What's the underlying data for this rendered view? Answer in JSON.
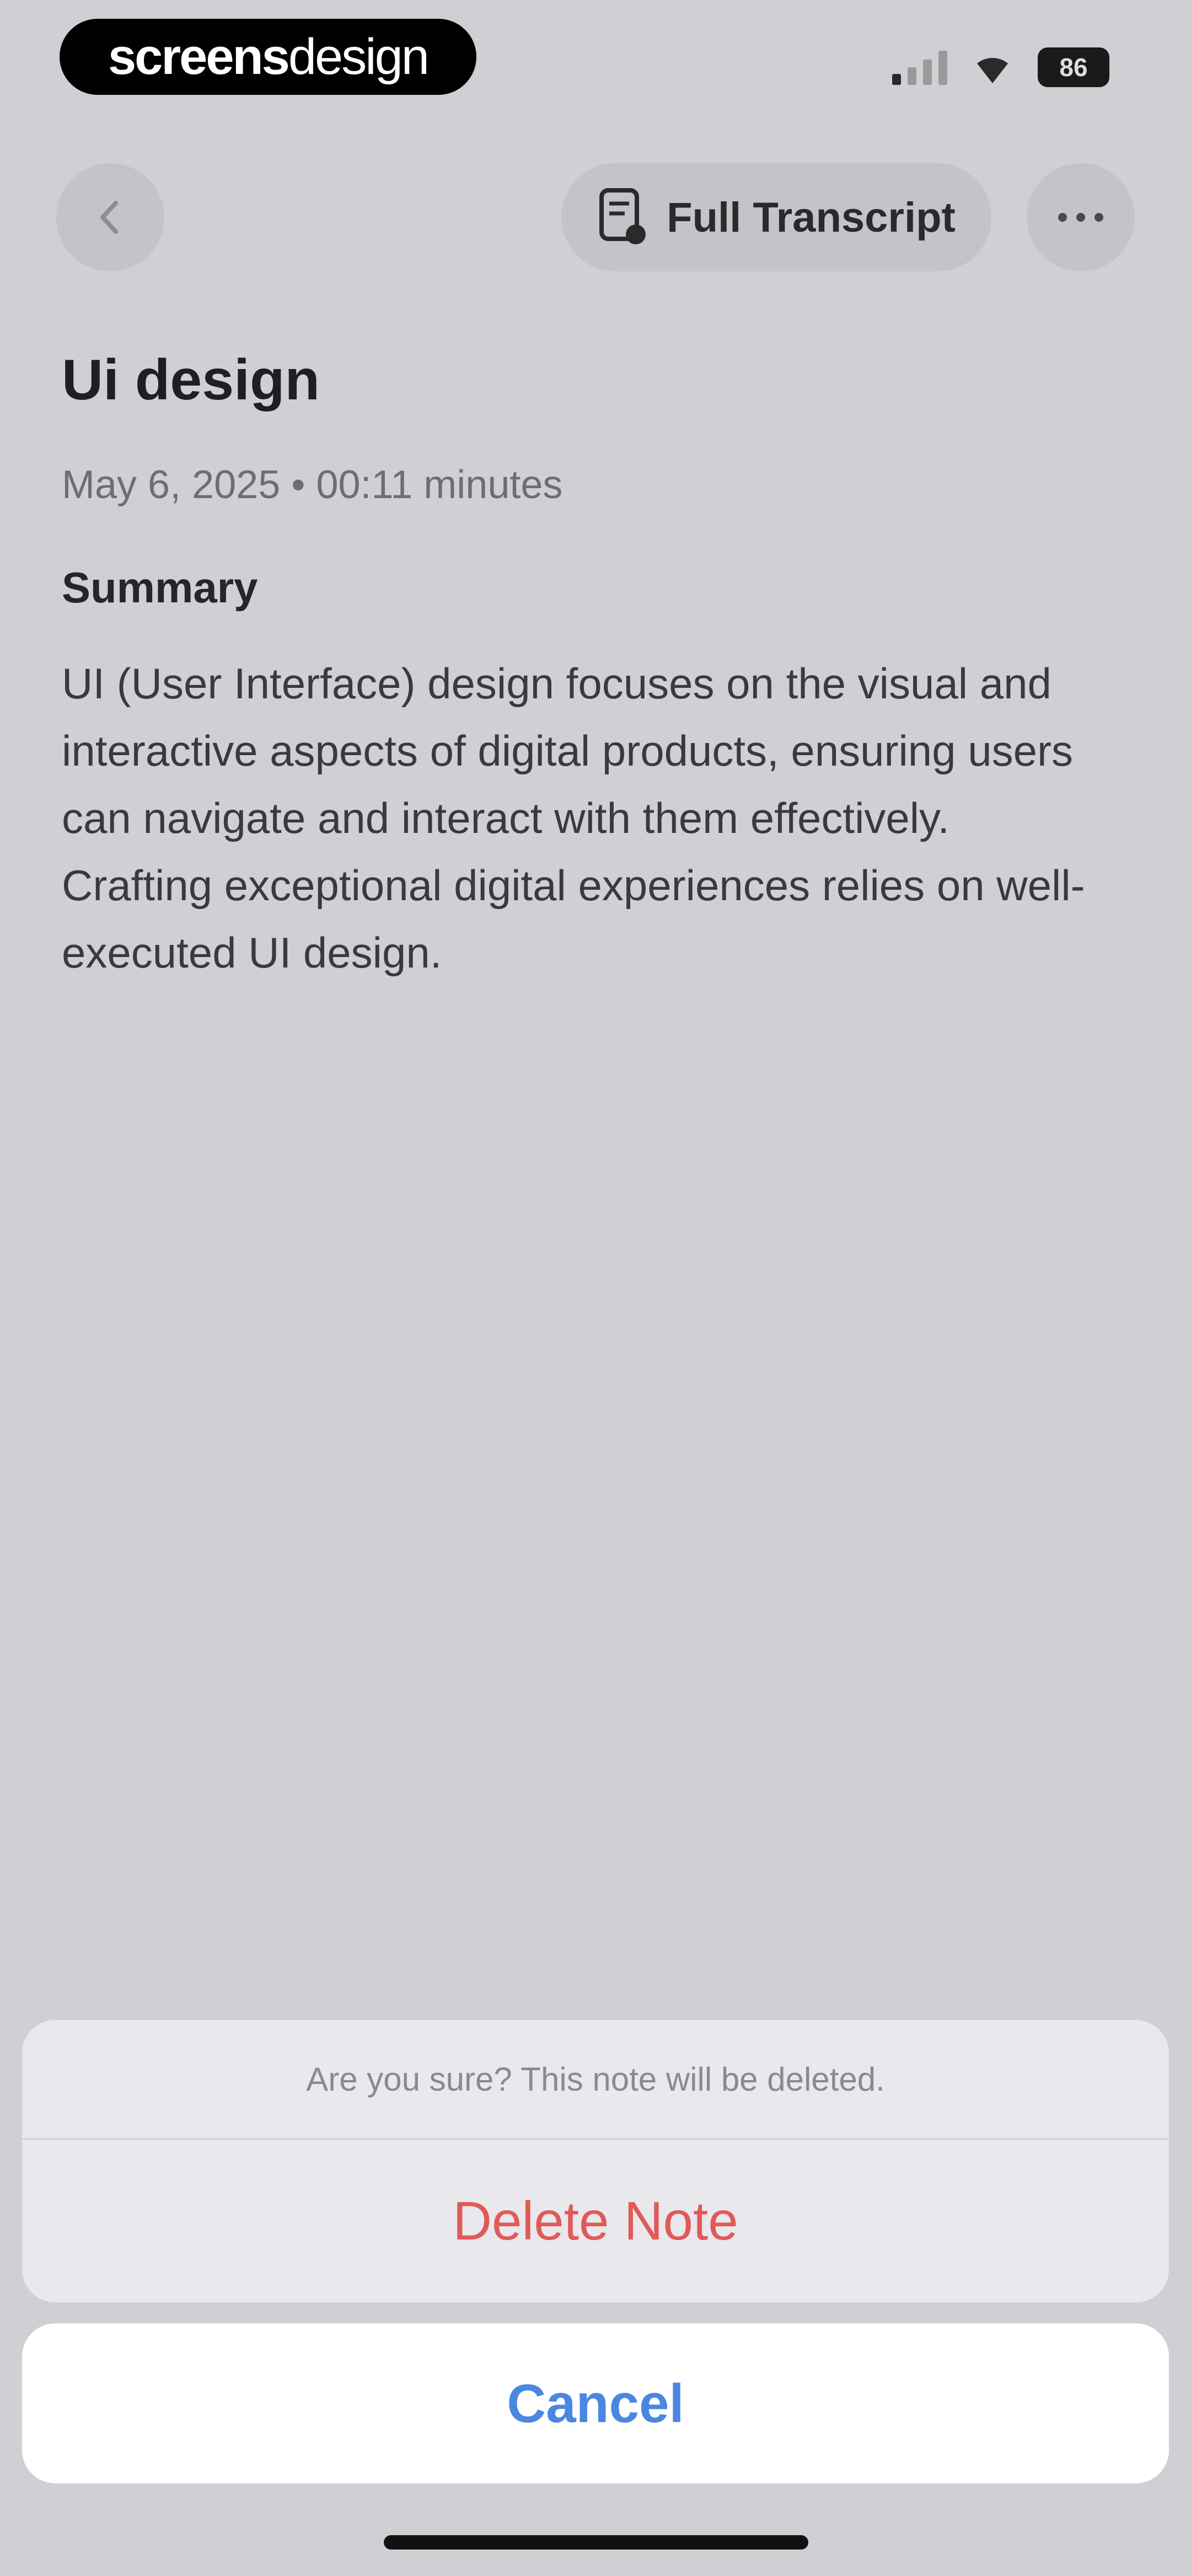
{
  "status_bar": {
    "logo_bold": "screens",
    "logo_light": "design",
    "signal_icon": "cellular-signal-icon",
    "wifi_icon": "wifi-icon",
    "battery_level": "86"
  },
  "header": {
    "back_icon": "chevron-left-icon",
    "transcript_icon": "document-icon",
    "transcript_label": "Full Transcript",
    "more_icon": "ellipsis-icon"
  },
  "note": {
    "title": "Ui design",
    "meta": "May 6, 2025 • 00:11 minutes",
    "summary_heading": "Summary",
    "summary_text": "UI (User Interface) design focuses on the visual and interactive aspects of digital products, ensuring users can navigate and interact with them effectively. Crafting exceptional digital experiences relies on well-executed UI design."
  },
  "action_sheet": {
    "message": "Are you sure? This note will be deleted.",
    "delete_label": "Delete Note",
    "cancel_label": "Cancel"
  },
  "colors": {
    "background": "#d0cfd3",
    "destructive": "#e05a57",
    "accent": "#4a87e0"
  }
}
